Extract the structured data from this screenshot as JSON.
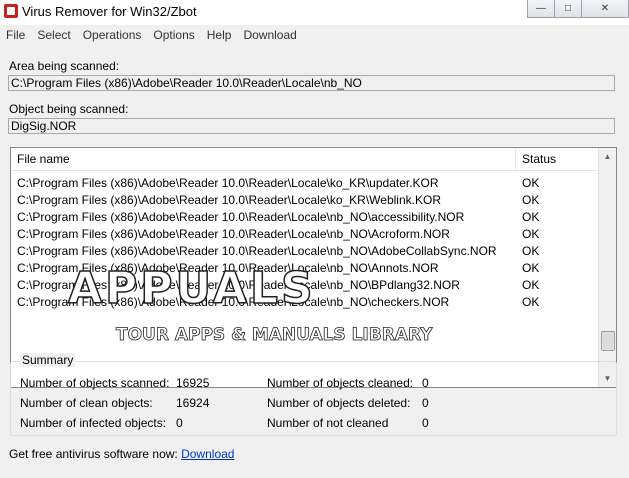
{
  "window": {
    "title": "Virus Remover for Win32/Zbot",
    "controls": {
      "minimize": "—",
      "maximize": "□",
      "close": "✕"
    }
  },
  "menu": [
    "File",
    "Select",
    "Operations",
    "Options",
    "Help",
    "Download"
  ],
  "scan": {
    "area_label": "Area being scanned:",
    "area_value": "C:\\Program Files (x86)\\Adobe\\Reader 10.0\\Reader\\Locale\\nb_NO",
    "object_label": "Object being scanned:",
    "object_value": "DigSig.NOR"
  },
  "table": {
    "headers": {
      "name": "File name",
      "status": "Status"
    },
    "rows": [
      {
        "name": "C:\\Program Files (x86)\\Adobe\\Reader 10.0\\Reader\\Locale\\ko_KR\\updater.KOR",
        "status": "OK"
      },
      {
        "name": "C:\\Program Files (x86)\\Adobe\\Reader 10.0\\Reader\\Locale\\ko_KR\\Weblink.KOR",
        "status": "OK"
      },
      {
        "name": "C:\\Program Files (x86)\\Adobe\\Reader 10.0\\Reader\\Locale\\nb_NO\\accessibility.NOR",
        "status": "OK"
      },
      {
        "name": "C:\\Program Files (x86)\\Adobe\\Reader 10.0\\Reader\\Locale\\nb_NO\\Acroform.NOR",
        "status": "OK"
      },
      {
        "name": "C:\\Program Files (x86)\\Adobe\\Reader 10.0\\Reader\\Locale\\nb_NO\\AdobeCollabSync.NOR",
        "status": "OK"
      },
      {
        "name": "C:\\Program Files (x86)\\Adobe\\Reader 10.0\\Reader\\Locale\\nb_NO\\Annots.NOR",
        "status": "OK"
      },
      {
        "name": "C:\\Program Files (x86)\\Adobe\\Reader 10.0\\Reader\\Locale\\nb_NO\\BPdlang32.NOR",
        "status": "OK"
      },
      {
        "name": "C:\\Program Files (x86)\\Adobe\\Reader 10.0\\Reader\\Locale\\nb_NO\\checkers.NOR",
        "status": "OK"
      }
    ],
    "scroll_up": "▲",
    "scroll_down": "▼"
  },
  "summary": {
    "title": "Summary",
    "scanned_label": "Number of objects scanned:",
    "scanned_value": "16925",
    "clean_label": "Number of clean objects:",
    "clean_value": "16924",
    "infected_label": "Number of infected objects:",
    "infected_value": "0",
    "cleaned_label": "Number of objects cleaned:",
    "cleaned_value": "0",
    "deleted_label": "Number of objects deleted:",
    "deleted_value": "0",
    "not_cleaned_label": "Number of not cleaned",
    "not_cleaned_value": "0"
  },
  "footer": {
    "text": "Get free antivirus software now:",
    "link": "Download"
  },
  "watermark": {
    "main": "APPUALS",
    "sub": "TOUR APPS & MANUALS LIBRARY"
  },
  "icons": {
    "app": "app-icon"
  }
}
